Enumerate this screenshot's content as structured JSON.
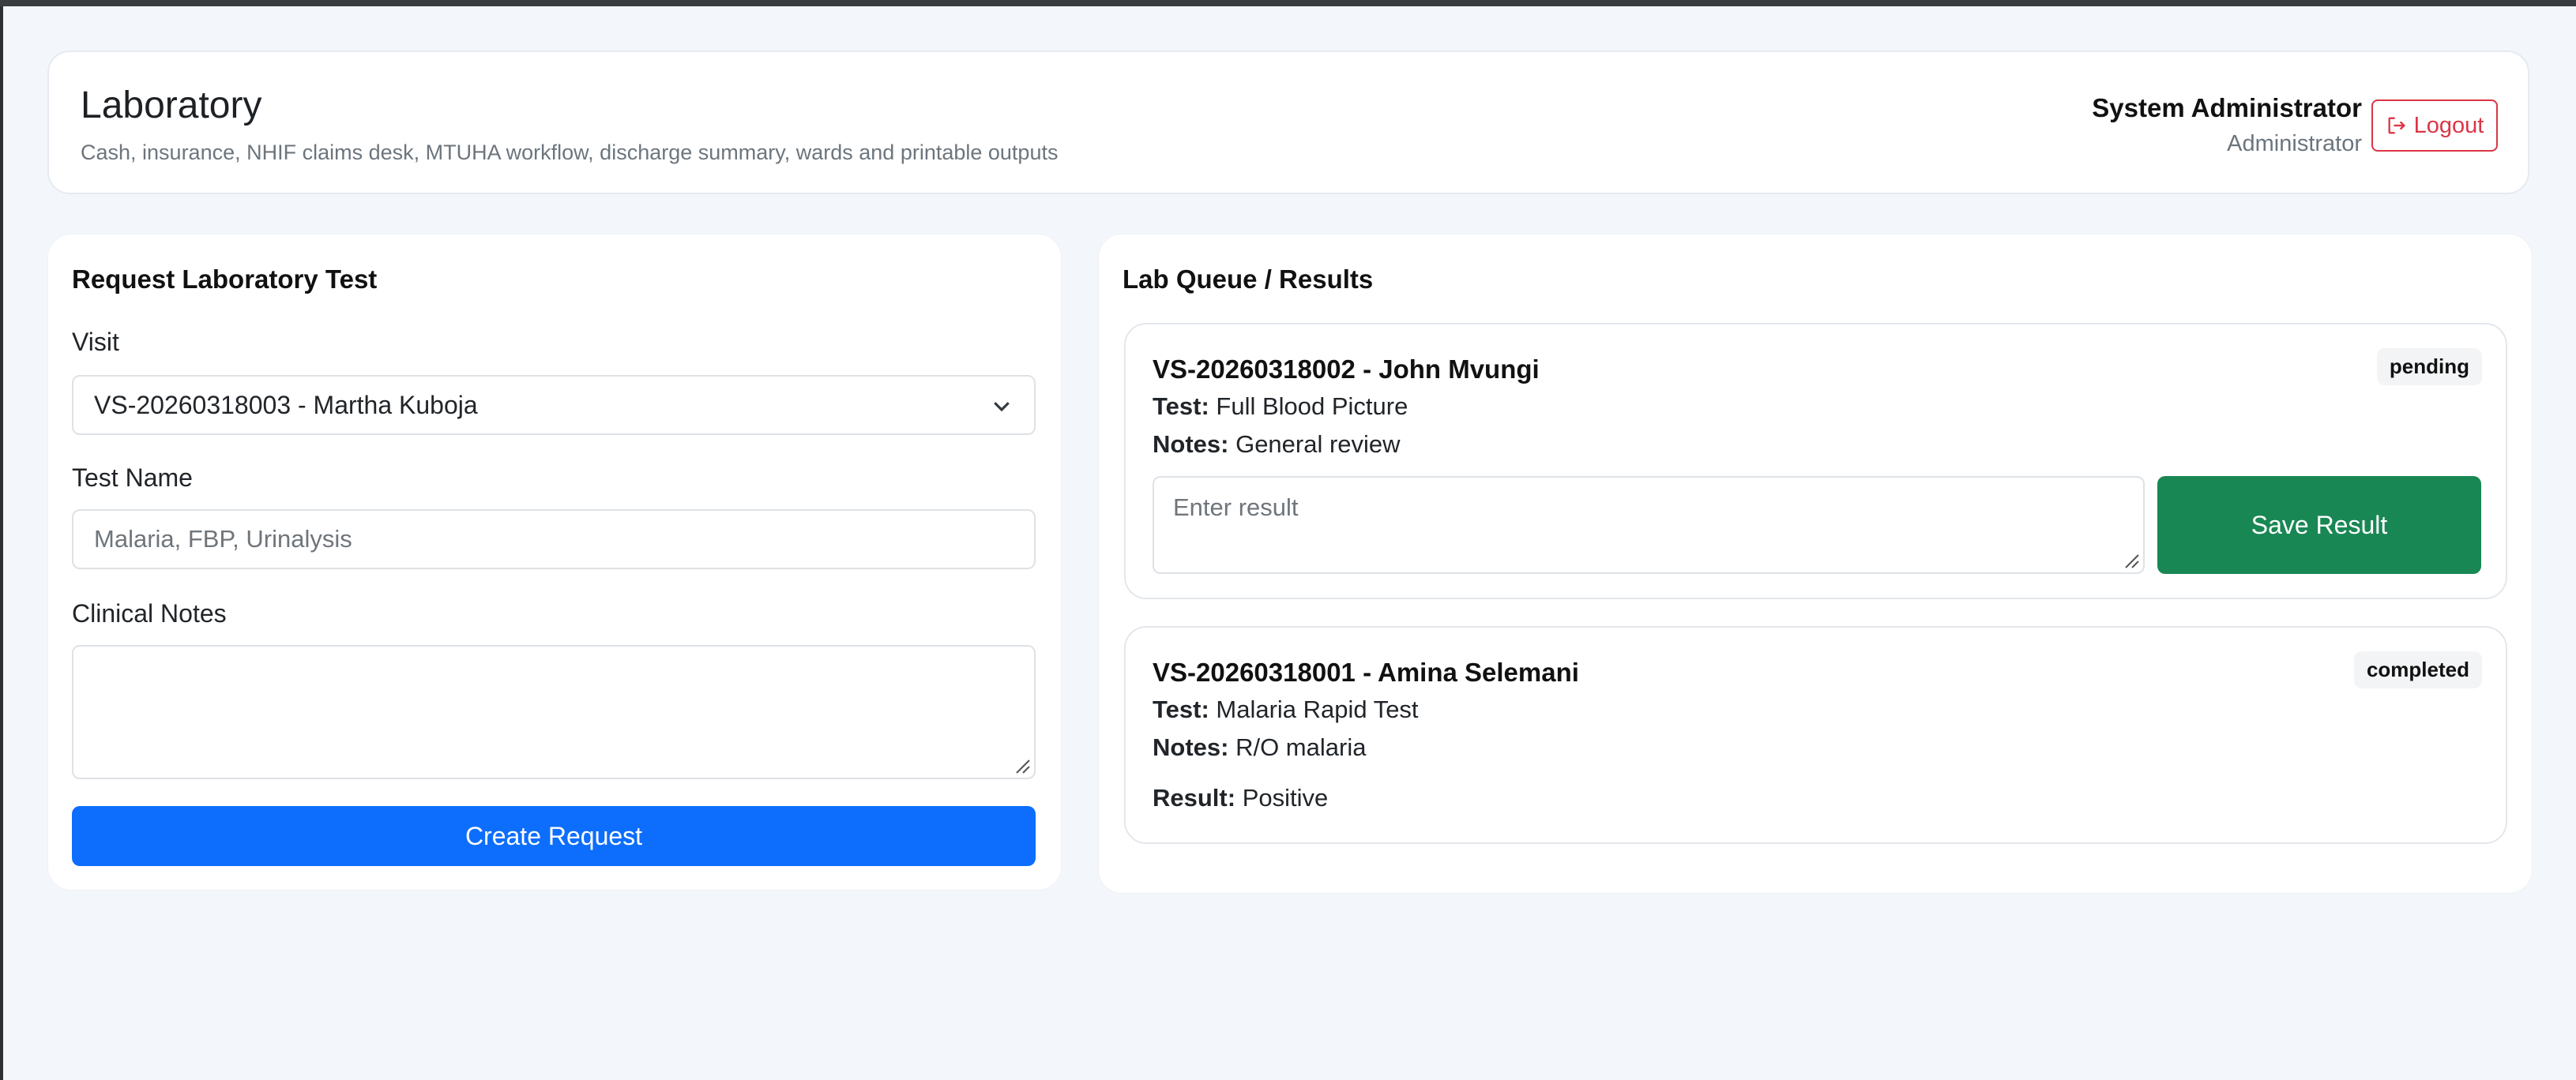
{
  "header": {
    "title": "Laboratory",
    "subtitle": "Cash, insurance, NHIF claims desk, MTUHA workflow, discharge summary, wards and printable outputs",
    "user_name": "System Administrator",
    "user_role": "Administrator",
    "logout_label": "Logout"
  },
  "request_form": {
    "title": "Request Laboratory Test",
    "visit_label": "Visit",
    "visit_selected": "VS-20260318003 - Martha Kuboja",
    "test_name_label": "Test Name",
    "test_name_placeholder": "Malaria, FBP, Urinalysis",
    "test_name_value": "",
    "clinical_notes_label": "Clinical Notes",
    "clinical_notes_value": "",
    "submit_label": "Create Request"
  },
  "queue": {
    "title": "Lab Queue / Results",
    "test_prefix": "Test:",
    "notes_prefix": "Notes:",
    "result_prefix": "Result:",
    "items": [
      {
        "visit": "VS-20260318002 - John Mvungi",
        "test": "Full Blood Picture",
        "notes": "General review",
        "status": "pending",
        "result_placeholder": "Enter result",
        "save_label": "Save Result"
      },
      {
        "visit": "VS-20260318001 - Amina Selemani",
        "test": "Malaria Rapid Test",
        "notes": "R/O malaria",
        "status": "completed",
        "result": "Positive"
      }
    ]
  },
  "colors": {
    "primary": "#0d6efd",
    "success": "#198754",
    "danger": "#dc3545",
    "background": "#f3f6fa"
  }
}
